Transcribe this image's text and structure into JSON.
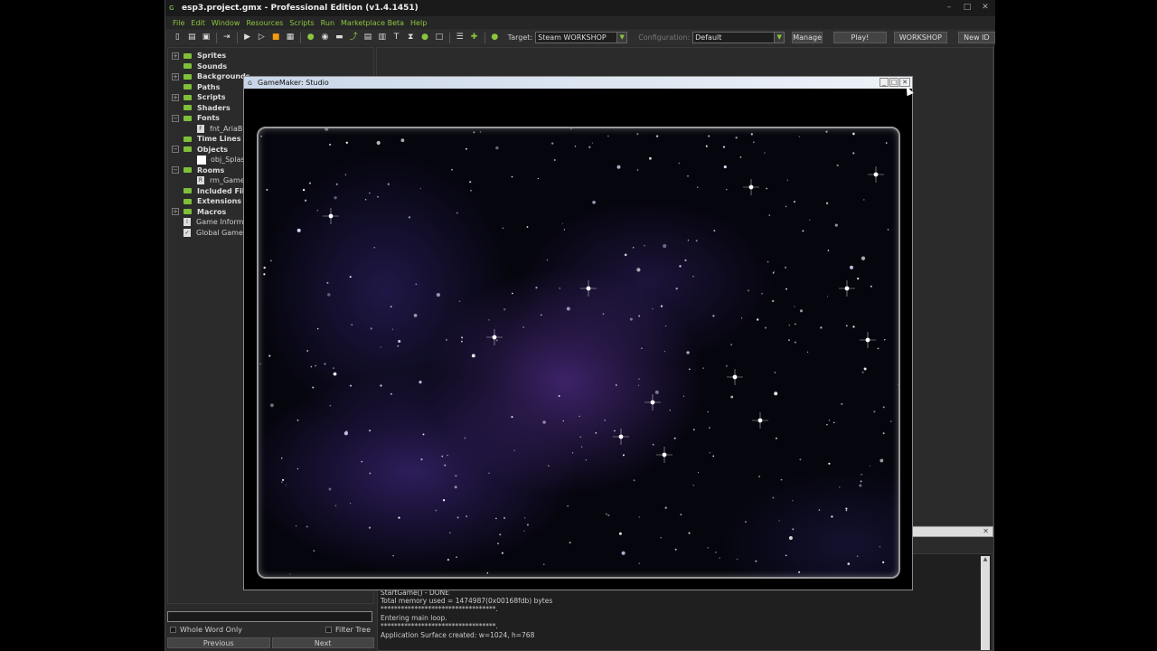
{
  "app": {
    "title": "esp3.project.gmx  -  Professional Edition (v1.4.1451)",
    "window_controls": [
      "–",
      "□",
      "✕"
    ]
  },
  "menu": [
    "File",
    "Edit",
    "Window",
    "Resources",
    "Scripts",
    "Run",
    "Marketplace Beta",
    "Help"
  ],
  "toolbar": {
    "target_label": "Target:",
    "target_value": "Steam WORKSHOP",
    "config_label": "Configuration:",
    "config_value": "Default",
    "manage": "Manage",
    "play": "Play!",
    "workshop": "WORKSHOP",
    "new_id": "New ID"
  },
  "tree": {
    "sprites": "Sprites",
    "sounds": "Sounds",
    "backgrounds": "Backgrounds",
    "paths": "Paths",
    "scripts": "Scripts",
    "shaders": "Shaders",
    "fonts": "Fonts",
    "font_child": "fnt_AriaBla",
    "time_lines": "Time Lines",
    "objects": "Objects",
    "object_child": "obj_Splash",
    "rooms": "Rooms",
    "room_child": "rm_Game",
    "included_files": "Included File",
    "extensions": "Extensions",
    "macros": "Macros",
    "game_information": "Game Informati",
    "global_game_settings": "Global Game Se"
  },
  "search": {
    "whole_word": "Whole Word Only",
    "filter_tree": "Filter Tree",
    "previous": "Previous",
    "next": "Next"
  },
  "output": {
    "lines": [
      "StartGame() - DONE",
      "Total memory used = 1474987(0x00168fdb) bytes",
      "**********************************.",
      "Entering main loop.",
      "**********************************.",
      "Application Surface created: w=1024, h=768"
    ]
  },
  "game_window": {
    "title": "GameMaker: Studio"
  }
}
